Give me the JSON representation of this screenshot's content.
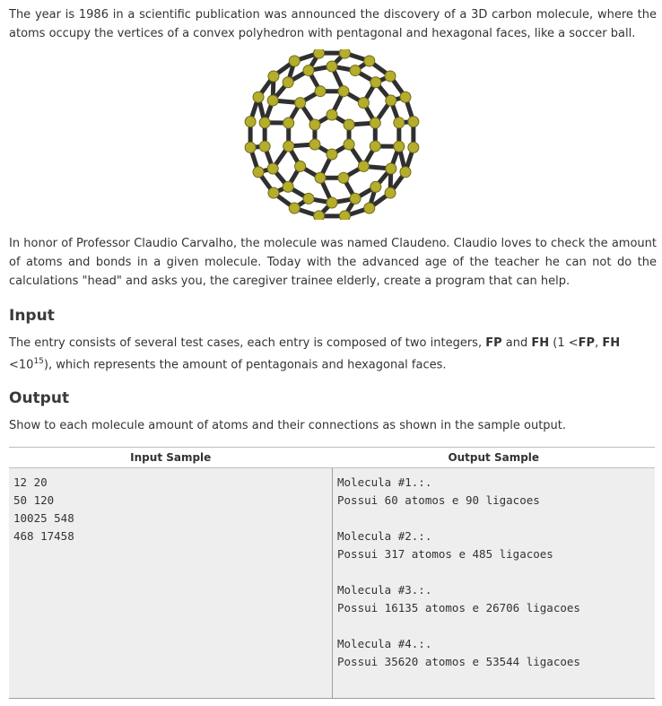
{
  "intro": "The year is 1986 in a scientific publication was announced the discovery of a 3D carbon molecule, where the atoms occupy the vertices of a convex polyhedron with pentagonal and hexagonal faces, like a soccer ball.",
  "honor": "In honor of Professor Claudio Carvalho, the molecule was named Claudeno. Claudio loves to check the amount of atoms and bonds in a given molecule. Today with the advanced age of the teacher he can not do the calculations \"head\" and asks you, the caregiver trainee elderly, create a program that can help.",
  "input_section": {
    "heading": "Input",
    "text_a": "The entry consists of several test cases, each entry is composed of two integers, ",
    "fp": "FP",
    "text_b": " and ",
    "fh": "FH",
    "text_c": " (1 <",
    "fp2": "FP",
    "text_d": ", ",
    "fh2": "FH",
    "text_e": " <10",
    "exp": "15",
    "text_f": "), which represents the amount of pentagonais and hexagonal faces."
  },
  "output_section": {
    "heading": "Output",
    "text": "Show to each molecule amount of atoms and their connections as shown in the sample output."
  },
  "samples": {
    "input_header": "Input Sample",
    "output_header": "Output Sample",
    "input_lines": [
      "12 20",
      "50 120",
      "10025 548",
      "468 17458"
    ],
    "output_lines": [
      "Molecula #1.:.",
      "Possui 60 atomos e 90 ligacoes",
      "",
      "Molecula #2.:.",
      "Possui 317 atomos e 485 ligacoes",
      "",
      "Molecula #3.:.",
      "Possui 16135 atomos e 26706 ligacoes",
      "",
      "Molecula #4.:.",
      "Possui 35620 atomos e 53544 ligacoes"
    ]
  },
  "figure": {
    "icon": "fullerene-molecule-image",
    "atom_color": "#b5ad2c",
    "bond_color": "#2f2f2f"
  }
}
